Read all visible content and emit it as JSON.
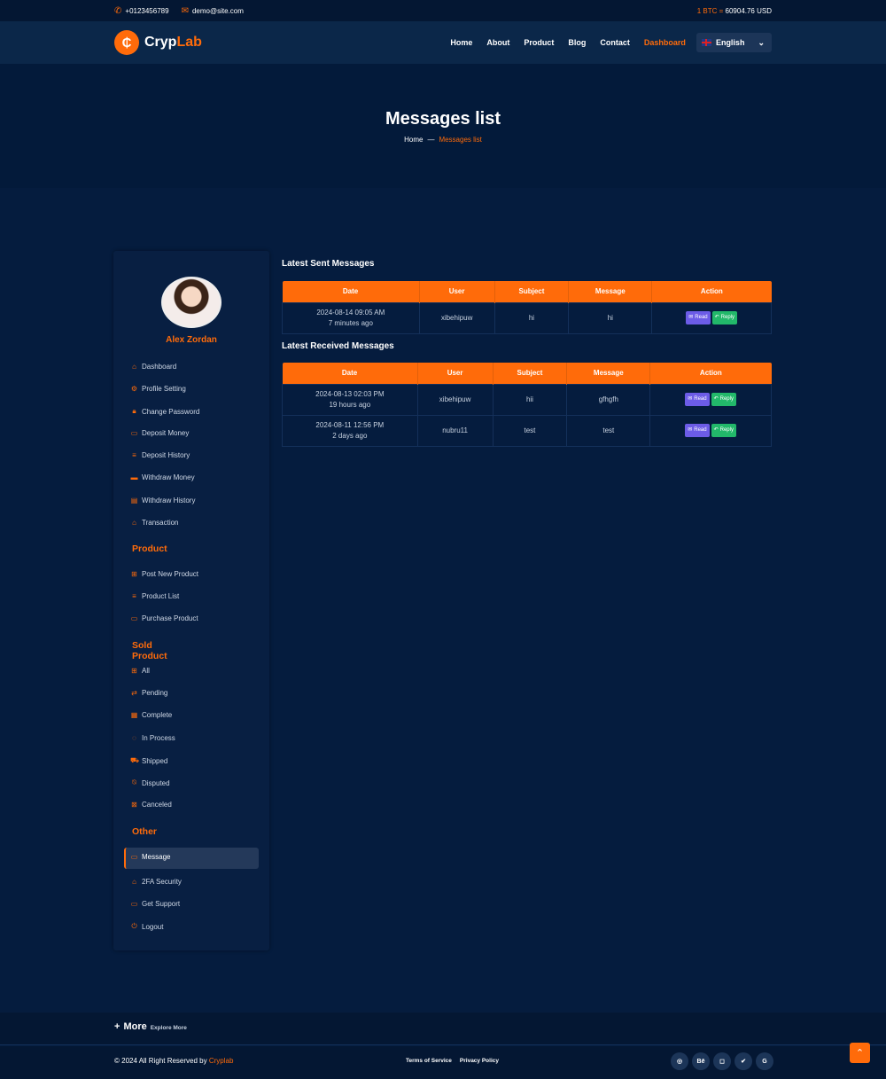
{
  "topbar": {
    "phone": "+0123456789",
    "email": "demo@site.com",
    "btc_label": "1 BTC =",
    "btc_value": "60904.76 USD"
  },
  "logo": {
    "mark": "₵",
    "text_a": "Cryp",
    "text_b": "Lab"
  },
  "nav": {
    "items": [
      "Home",
      "About",
      "Product",
      "Blog",
      "Contact",
      "Dashboard"
    ],
    "language": "English"
  },
  "hero": {
    "title": "Messages list",
    "crumb_home": "Home",
    "crumb_sep": "—",
    "crumb_current": "Messages list"
  },
  "user": {
    "name": "Alex Zordan"
  },
  "sidebar": {
    "main": [
      "Dashboard",
      "Profile Setting",
      "Change Password",
      "Deposit Money",
      "Deposit History",
      "Withdraw Money",
      "Withdraw History",
      "Transaction"
    ],
    "product_heading": "Product",
    "product": [
      "Post New Product",
      "Product List",
      "Purchase Product"
    ],
    "sold_heading": "Sold Product",
    "sold": [
      "All",
      "Pending",
      "Complete",
      "In Process",
      "Shipped",
      "Disputed",
      "Canceled"
    ],
    "other_heading": "Other",
    "other": [
      "Message",
      "2FA Security",
      "Get Support",
      "Logout"
    ]
  },
  "sent": {
    "title": "Latest Sent Messages",
    "headers": [
      "Date",
      "User",
      "Subject",
      "Message",
      "Action"
    ],
    "rows": [
      {
        "date": "2024-08-14 09:05 AM",
        "ago": "7 minutes ago",
        "user": "xibehipuw",
        "subject": "hi",
        "message": "hi"
      }
    ]
  },
  "received": {
    "title": "Latest Received Messages",
    "headers": [
      "Date",
      "User",
      "Subject",
      "Message",
      "Action"
    ],
    "rows": [
      {
        "date": "2024-08-13 02:03 PM",
        "ago": "19 hours ago",
        "user": "xibehipuw",
        "subject": "hii",
        "message": "gfhgfh"
      },
      {
        "date": "2024-08-11 12:56 PM",
        "ago": "2 days ago",
        "user": "nubru11",
        "subject": "test",
        "message": "test"
      }
    ]
  },
  "actions": {
    "read": "Read",
    "reply": "Reply"
  },
  "footer": {
    "more": "More",
    "explore": "Explore More",
    "copyright": "© 2024 All Right Reserved by",
    "brand": "Cryplab",
    "terms": "Terms of Service",
    "privacy": "Privacy Policy"
  },
  "colors": {
    "accent": "#ff6b0a",
    "background": "#051c3e",
    "read": "#6c5ce7",
    "reply": "#22b86a"
  }
}
